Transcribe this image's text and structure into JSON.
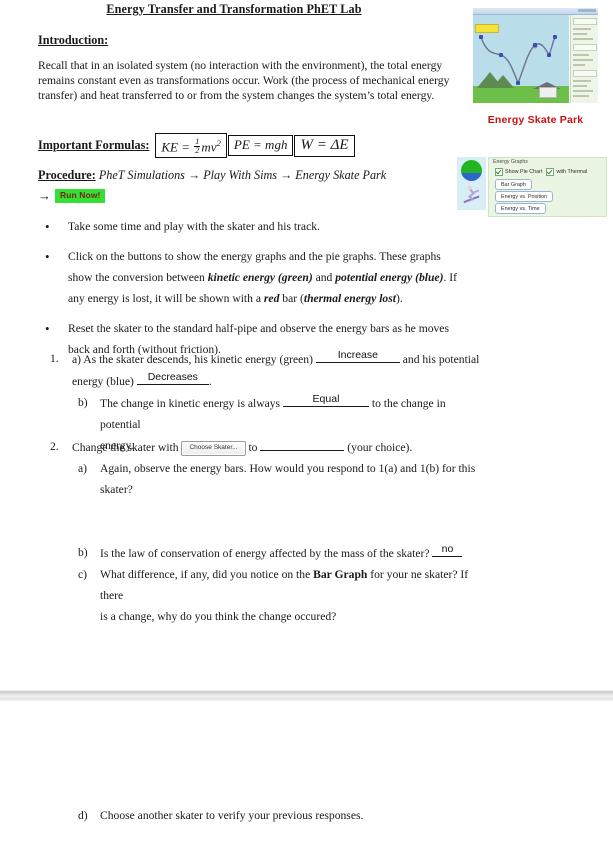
{
  "document": {
    "title": "Energy Transfer and Transformation PhET Lab",
    "intro_heading": "Introduction:",
    "intro_body": "Recall that in an isolated system (no interaction with the environment), the total energy remains constant even as transformations occur. Work (the process of mechanical energy transfer) and heat transferred to or from the system changes the system’s total energy.",
    "formulas_label": "Important Formulas:",
    "formulas": {
      "ke": {
        "lhs": "KE",
        "eq": "=",
        "num": "1",
        "den": "2",
        "body": "mv",
        "exp": "2"
      },
      "pe": "PE = mgh",
      "work": "W = ΔE"
    },
    "procedure": {
      "label": "Procedure:",
      "step1": "PheT Simulations",
      "arrow": "→",
      "step2": "Play With Sims",
      "step3": "Energy Skate Park",
      "run_button": "Run Now!"
    },
    "bullets": [
      "Take some time and play with the skater and his track.",
      "Click on the buttons to show the energy graphs and the pie graphs.  These graphs show the conversion between ",
      "Reset the skater to the standard half-pipe and observe the energy bars as he moves back and forth (without friction)."
    ],
    "bullet2_parts": {
      "lead": "Click on the buttons to show the energy graphs and the pie graphs.  These graphs show the conversion between ",
      "kinetic": "kinetic energy (green)",
      "and": " and ",
      "potential": "potential energy (blue)",
      "mid": ".  If any energy is lost, it will be shown with a ",
      "red": "red",
      "bar": " bar (",
      "thermal": "thermal energy lost",
      "end": ")."
    },
    "questions": {
      "q1": {
        "number": "1.",
        "a_marker": "a)",
        "a_text_1": "As the skater descends, his kinetic energy (green)",
        "a_answer_1": "Increase",
        "a_text_2": "and his potential",
        "a_text_3": "energy (blue)",
        "a_answer_2": "Decreases",
        "a_text_4": ".",
        "b_marker": "b)",
        "b_text_1": "The change in kinetic energy is always",
        "b_answer": "Equal",
        "b_text_2": "to the change in potential",
        "b_text_3": "energy."
      },
      "q2": {
        "number": "2.",
        "lead": "Change the skater with",
        "button_label": "Choose Skater...",
        "mid": "to",
        "choice_answer": "",
        "tail": "(your choice).",
        "a_marker": "a)",
        "a_text_1": "Again, observe the energy bars. How would you respond to 1(a) and 1(b) for this",
        "a_text_2": "skater?",
        "b_marker": "b)",
        "b_text": "Is the law of conservation of energy affected by the mass of the skater?",
        "b_answer": "no",
        "c_marker": "c)",
        "c_text_1": "What difference, if any, did you notice on the ",
        "c_bold": "Bar Graph",
        "c_text_2": " for your ne skater? If there",
        "c_text_3": "is a change, why do you think the change occured?",
        "d_marker": "d)",
        "d_text": "Choose another skater to verify your previous responses."
      }
    },
    "figures": {
      "skatepark": {
        "caption": "Energy Skate Park",
        "caption_color": "#c41212",
        "sky_color": "#b9dde9",
        "ground_color": "#6cc04a"
      },
      "energy_graphs": {
        "group_label": "Energy Graphs",
        "checkbox_pie": "Show Pie Chart",
        "checkbox_thermal": "with Thermal",
        "button_bar": "Bar Graph",
        "button_position": "Energy vs. Position",
        "button_time": "Energy vs. Time",
        "pie_green": "#22b422",
        "pie_blue": "#2a66c8"
      }
    }
  }
}
